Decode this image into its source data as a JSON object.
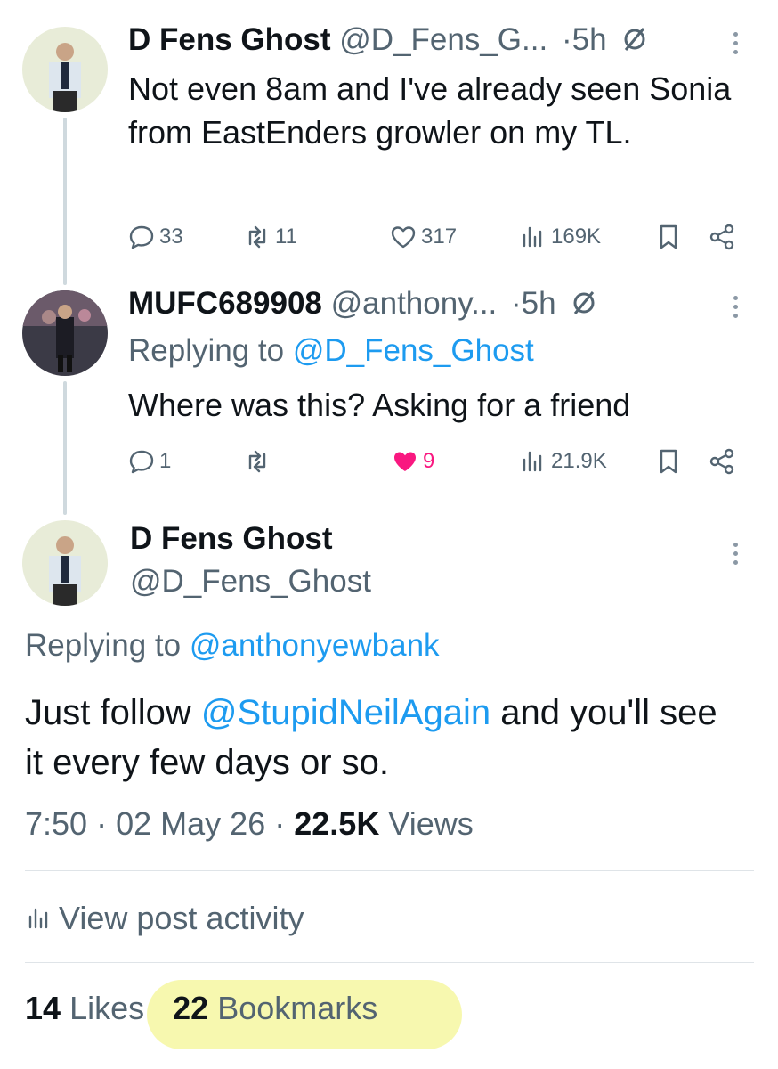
{
  "tweet1": {
    "display_name": "D Fens Ghost",
    "handle": "@D_Fens_G...",
    "separator": "·",
    "time": "5h",
    "text": "Not even 8am and I've already seen Sonia from EastEnders growler on my TL.",
    "replies": "33",
    "retweets": "11",
    "likes": "317",
    "views": "169K"
  },
  "tweet2": {
    "display_name": "MUFC689908",
    "handle": "@anthony...",
    "separator": "·",
    "time": "5h",
    "replying_prefix": "Replying to",
    "replying_to": "@D_Fens_Ghost",
    "text": "Where was this? Asking for a friend",
    "replies": "1",
    "retweets": "",
    "likes": "9",
    "views": "21.9K"
  },
  "main": {
    "display_name": "D Fens Ghost",
    "handle": "@D_Fens_Ghost",
    "replying_prefix": "Replying to",
    "replying_to": "@anthonyewbank",
    "text_before": "Just follow ",
    "mention": "@StupidNeilAgain",
    "text_after": " and you'll see it every few days or so.",
    "time": "7:50",
    "date": "02 May 26",
    "views_count": "22.5K",
    "views_label": "Views",
    "separator": "·",
    "activity_label": "View post activity",
    "likes_count": "14",
    "likes_label": "Likes",
    "bookmarks_count": "22",
    "bookmarks_label": "Bookmarks"
  },
  "colors": {
    "link": "#1d9bf0",
    "muted": "#536471",
    "like_active": "#f91880",
    "highlight": "#f6f7a6"
  },
  "icons": [
    "reply-icon",
    "retweet-icon",
    "like-icon",
    "views-icon",
    "bookmark-icon",
    "share-icon",
    "more-icon",
    "ghost-mute-icon"
  ]
}
